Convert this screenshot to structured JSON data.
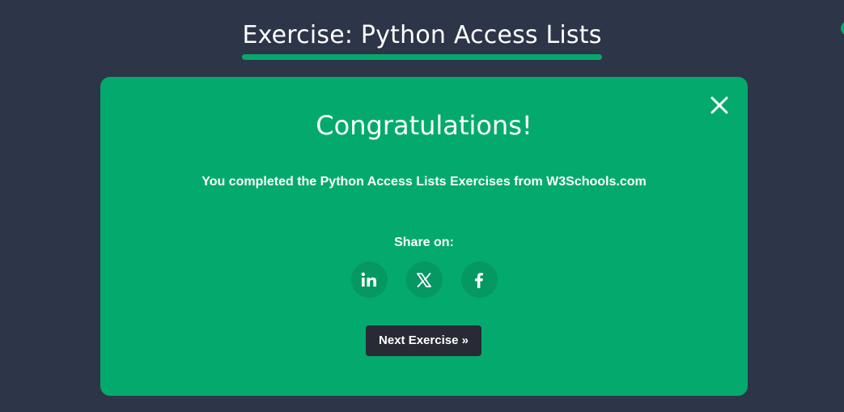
{
  "header": {
    "title": "Exercise: Python Access Lists"
  },
  "modal": {
    "heading": "Congratulations!",
    "message": "You completed the Python Access Lists Exercises from W3Schools.com",
    "share_label": "Share on:",
    "share_buttons": [
      {
        "name": "linkedin",
        "icon": "linkedin-icon"
      },
      {
        "name": "x",
        "icon": "x-icon"
      },
      {
        "name": "facebook",
        "icon": "facebook-icon"
      }
    ],
    "next_button_label": "Next Exercise »",
    "close_icon": "close-icon"
  },
  "colors": {
    "background": "#2d3548",
    "accent": "#04aa6d",
    "share_button_bg": "#059862",
    "next_button_bg": "#282a35",
    "text": "#ffffff"
  }
}
